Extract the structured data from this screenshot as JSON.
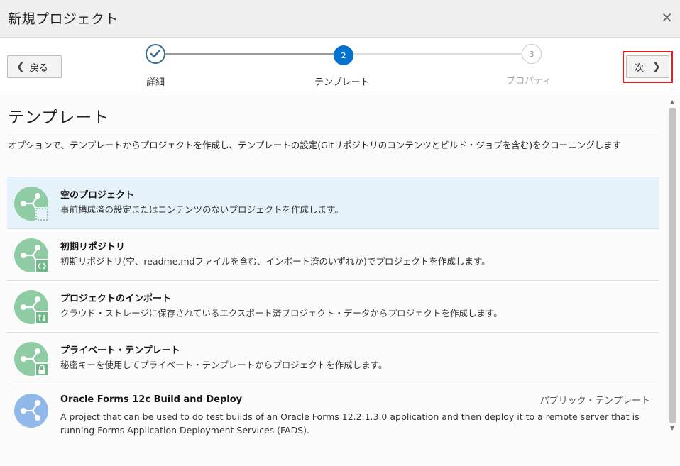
{
  "dialog": {
    "title": "新規プロジェクト",
    "close": "×"
  },
  "train": {
    "back_label": "戻る",
    "next_label": "次",
    "steps": [
      {
        "number": "✓",
        "label": "詳細"
      },
      {
        "number": "2",
        "label": "テンプレート"
      },
      {
        "number": "3",
        "label": "プロパティ"
      }
    ]
  },
  "section": {
    "title": "テンプレート",
    "description": "オプションで、テンプレートからプロジェクトを作成し、テンプレートの設定(Gitリポジトリのコンテンツとビルド・ジョブを含む)をクローニングします"
  },
  "templates": [
    {
      "name": "空のプロジェクト",
      "desc": "事前構成済の設定またはコンテンツのないプロジェクトを作成します。",
      "icon": "empty-project-icon",
      "badge": "dashed-square"
    },
    {
      "name": "初期リポジトリ",
      "desc": "初期リポジトリ(空、readme.mdファイルを含む、インポート済のいずれか)でプロジェクトを作成します。",
      "icon": "initial-repository-icon",
      "badge": "code-brackets"
    },
    {
      "name": "プロジェクトのインポート",
      "desc": "クラウド・ストレージに保存されているエクスポート済プロジェクト・データからプロジェクトを作成します。",
      "icon": "import-project-icon",
      "badge": "import-arrows"
    },
    {
      "name": "プライベート・テンプレート",
      "desc": "秘密キーを使用してプライベート・テンプレートからプロジェクトを作成します。",
      "icon": "private-template-icon",
      "badge": "lock"
    },
    {
      "name": "Oracle Forms 12c Build and Deploy",
      "desc": "A project that can be used to do test builds of an Oracle Forms 12.2.1.3.0 application and then deploy it to a remote server that is running Forms Application Deployment Services (FADS).",
      "icon": "public-template-icon",
      "tag": "パブリック・テンプレート"
    }
  ],
  "colors": {
    "accent": "#0572ce",
    "green_icon": "#8fcca4",
    "blue_icon": "#90b8e8",
    "selected_row": "#e6f2fa",
    "highlight_frame": "#e02020"
  }
}
